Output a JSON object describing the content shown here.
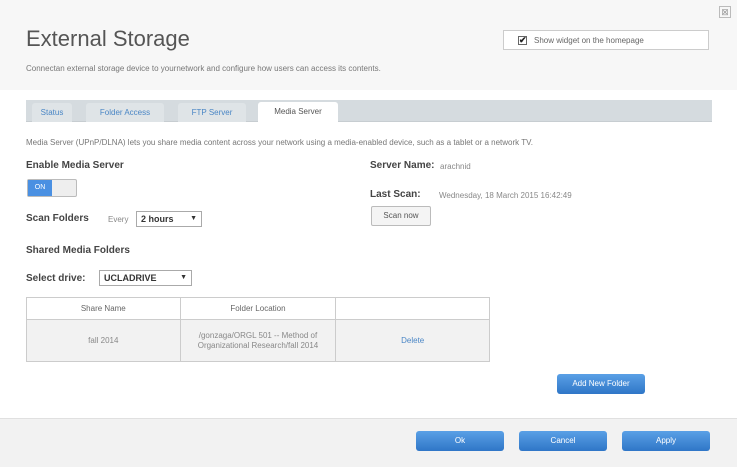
{
  "window": {
    "close_glyph": "⊠",
    "title": "External Storage",
    "subtitle": "Connectan external storage device to yournetwork and configure how users can access its contents."
  },
  "widget": {
    "checked": true,
    "label": "Show widget on the homepage"
  },
  "tabs": [
    {
      "label": "Status",
      "active": false
    },
    {
      "label": "Folder Access",
      "active": false
    },
    {
      "label": "FTP Server",
      "active": false
    },
    {
      "label": "Media Server",
      "active": true
    }
  ],
  "media_server": {
    "description": "Media Server (UPnP/DLNA) lets you share media content across your network using a media-enabled device, such as a tablet or a network TV.",
    "enable_label": "Enable Media Server",
    "toggle_state": "ON",
    "server_name_label": "Server Name:",
    "server_name_value": "arachnid",
    "last_scan_label": "Last Scan:",
    "last_scan_value": "Wednesday, 18 March 2015 16:42:49",
    "scan_now_label": "Scan now",
    "scan_folders_label": "Scan Folders",
    "every_label": "Every",
    "scan_interval": "2 hours",
    "shared_folders_label": "Shared Media Folders",
    "select_drive_label": "Select drive:",
    "drive_value": "UCLADRIVE"
  },
  "table": {
    "columns": [
      "Share Name",
      "Folder Location",
      ""
    ],
    "rows": [
      {
        "share_name": "fall 2014",
        "folder_location": "/gonzaga/ORGL 501 -- Method of Organizational Research/fall 2014",
        "action": "Delete"
      }
    ]
  },
  "buttons": {
    "add_folder": "Add New Folder",
    "ok": "Ok",
    "cancel": "Cancel",
    "apply": "Apply"
  },
  "colors": {
    "accent": "#4a90e2",
    "link": "#4a86c5"
  }
}
